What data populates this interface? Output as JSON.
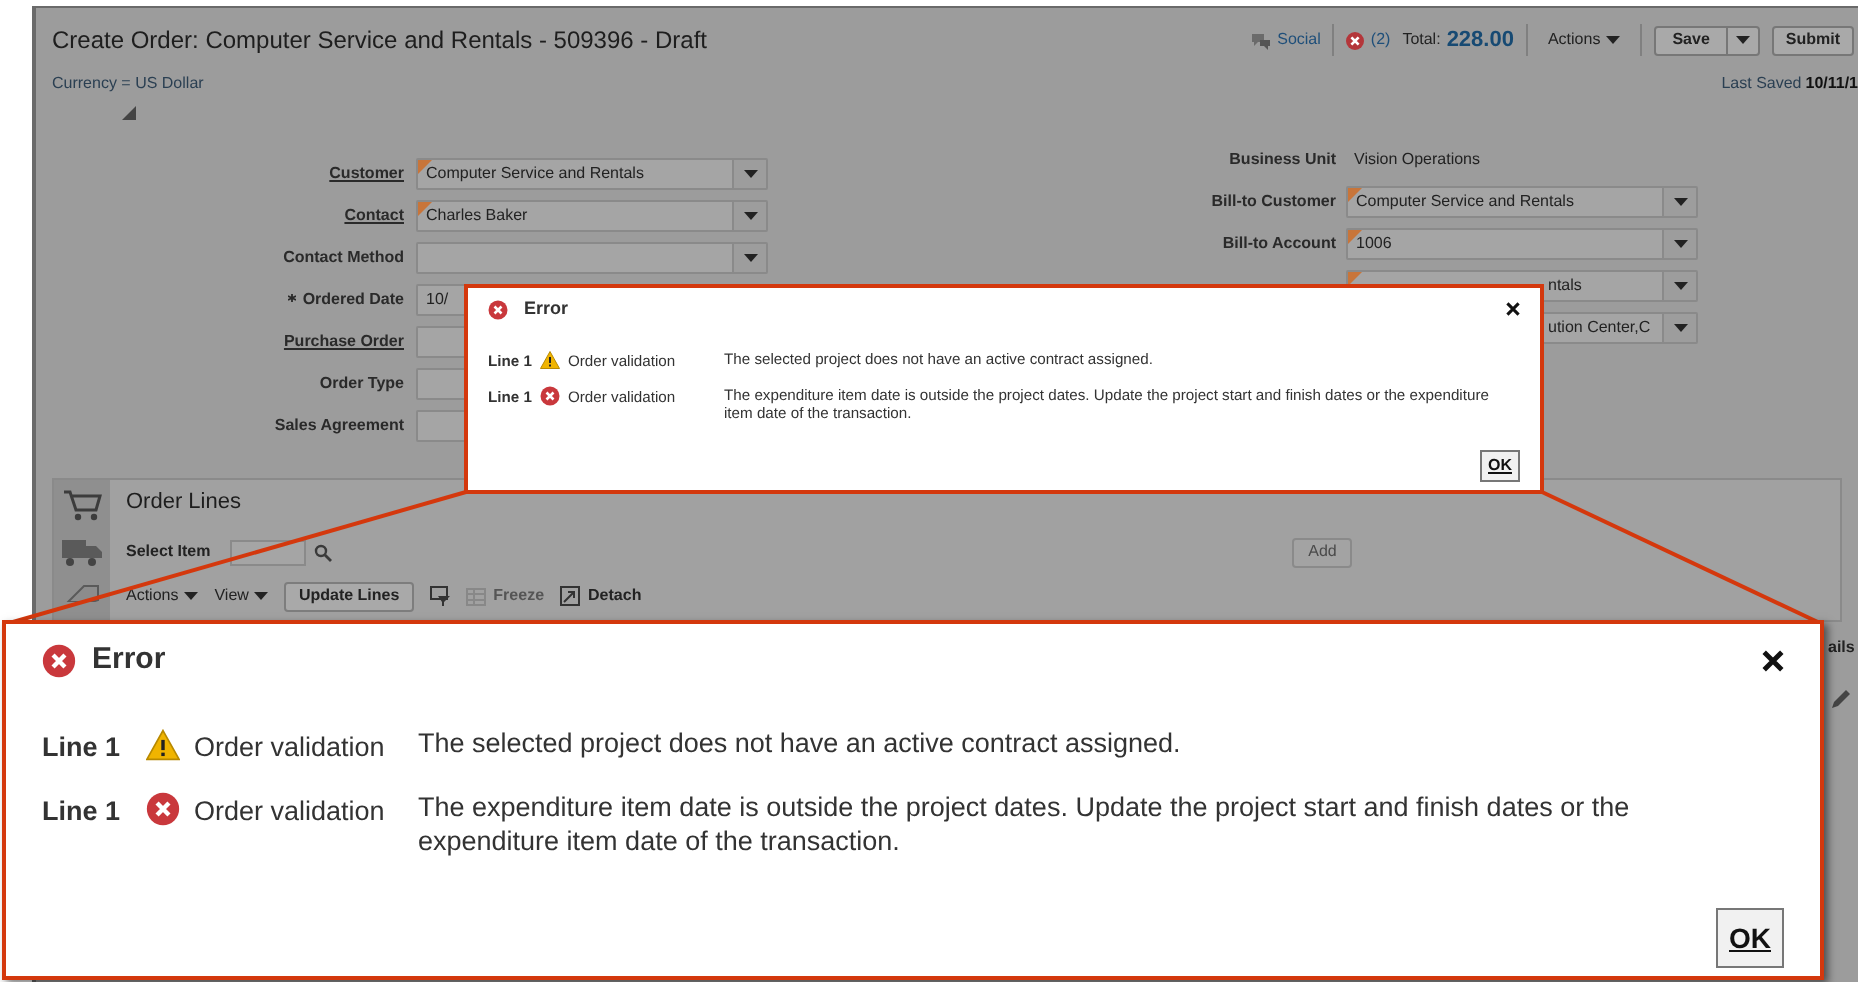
{
  "header": {
    "title": "Create Order: Computer Service and Rentals - 509396 - Draft",
    "social": "Social",
    "error_count": "(2)",
    "total_label": "Total:",
    "total": "228.00",
    "actions": "Actions",
    "save": "Save",
    "submit": "Submit",
    "currency": "Currency = US Dollar",
    "last_saved_label": "Last Saved",
    "last_saved": "10/11/1"
  },
  "form_left": [
    {
      "label": "Customer",
      "value": "Computer Service and Rentals",
      "kind": "select",
      "link": true,
      "required": false,
      "marked": true
    },
    {
      "label": "Contact",
      "value": "Charles Baker",
      "kind": "select",
      "link": true,
      "required": false,
      "marked": true
    },
    {
      "label": "Contact Method",
      "kind": "select",
      "link": false,
      "required": false,
      "marked": false
    },
    {
      "label": "Ordered Date",
      "value": "10/",
      "kind": "input",
      "link": false,
      "required": true,
      "marked": false
    },
    {
      "label": "Purchase Order",
      "kind": "input",
      "link": true,
      "required": false,
      "marked": false
    },
    {
      "label": "Order Type",
      "kind": "input",
      "link": false,
      "required": false,
      "marked": false
    },
    {
      "label": "Sales Agreement",
      "kind": "input",
      "link": false,
      "required": false,
      "marked": false
    }
  ],
  "form_right": [
    {
      "label": "Business Unit",
      "value": "Vision Operations",
      "kind": "text",
      "marked": false
    },
    {
      "label": "Bill-to Customer",
      "value": "Computer Service and Rentals",
      "kind": "select",
      "marked": true
    },
    {
      "label": "Bill-to Account",
      "value": "1006",
      "kind": "select",
      "marked": true
    },
    {
      "value": "ntals",
      "kind": "select",
      "marked": true
    },
    {
      "value": "ution Center,C",
      "kind": "select",
      "marked": false
    }
  ],
  "order_lines": {
    "title": "Order Lines",
    "select_item": "Select Item",
    "add": "Add",
    "add_disabled": true,
    "toolbar": [
      {
        "label": "Actions",
        "kind": "menu",
        "disabled": false
      },
      {
        "label": "View",
        "kind": "menu",
        "disabled": false
      },
      {
        "label": "Update Lines",
        "kind": "button",
        "disabled": false
      },
      {
        "kind": "icon",
        "disabled": false
      },
      {
        "label": "Freeze",
        "kind": "icon_button",
        "disabled": true
      },
      {
        "label": "Detach",
        "kind": "icon_button",
        "disabled": false
      }
    ],
    "column_fragment": "ails"
  },
  "dialogs": [
    {
      "title": "Error",
      "ok": "OK",
      "messages": [
        {
          "line": "Line 1",
          "kind": "warning",
          "source": "Order validation",
          "text": "The selected project does not have an active contract assigned."
        },
        {
          "line": "Line 1",
          "kind": "error",
          "source": "Order validation",
          "text": "The expenditure item date is outside the project dates. Update the project start and finish dates or the expenditure item date of the transaction."
        }
      ]
    },
    {
      "title": "Error",
      "ok": "OK",
      "messages": [
        {
          "line": "Line 1",
          "kind": "warning",
          "source": "Order validation",
          "text": "The selected project does not have an active contract assigned."
        },
        {
          "line": "Line 1",
          "kind": "error",
          "source": "Order validation",
          "text": "The expenditure item date is outside the project dates. Update the project start and finish dates or the expenditure item date of the transaction."
        }
      ]
    }
  ]
}
